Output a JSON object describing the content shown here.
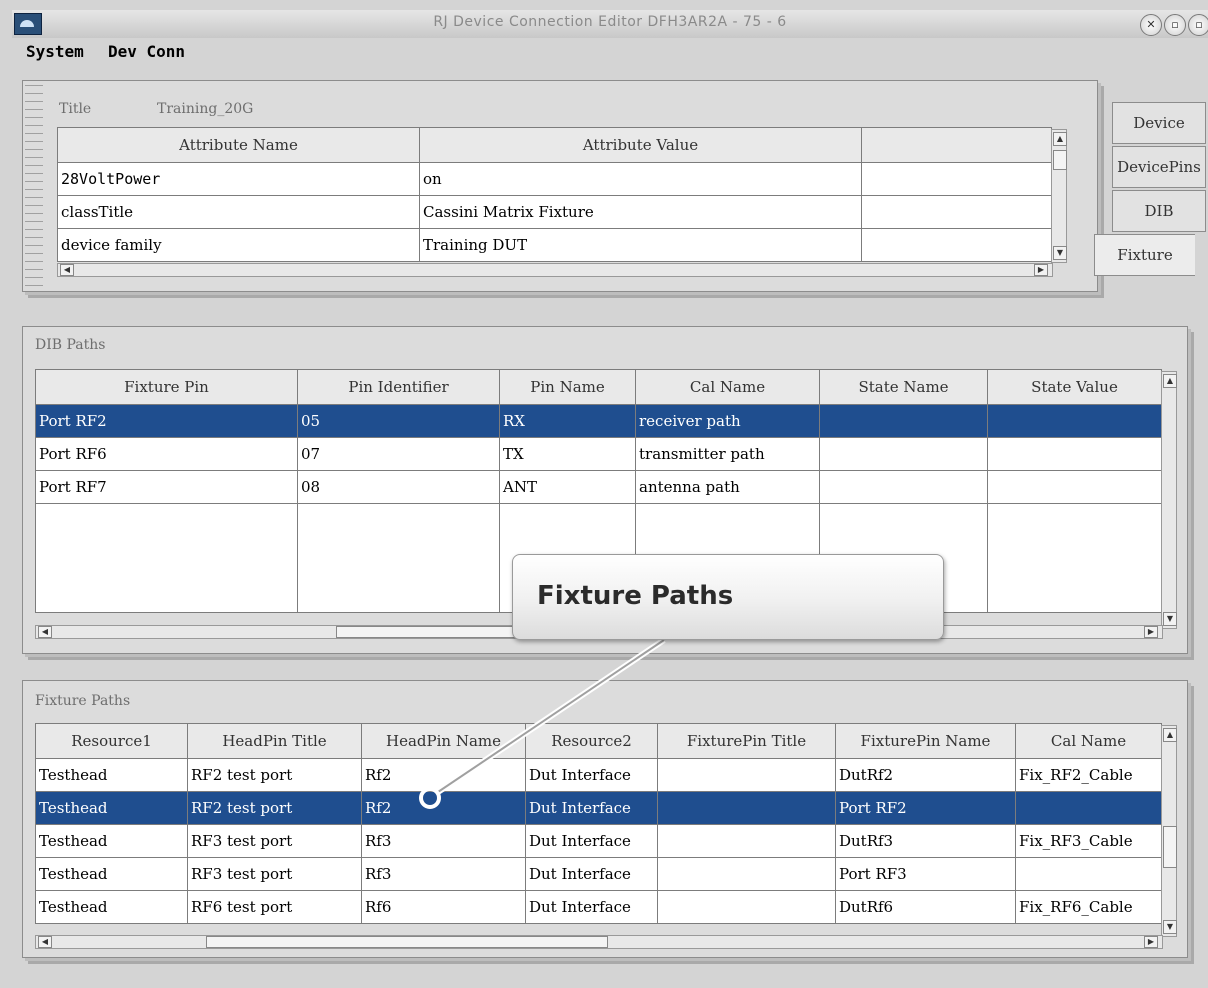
{
  "window": {
    "title": "RJ Device Connection Editor DFH3AR2A - 75 - 6"
  },
  "menu": [
    {
      "label": "System"
    },
    {
      "label": "Dev Conn"
    }
  ],
  "attributes": {
    "title_label": "Title",
    "title_value": "Training_20G",
    "columns": [
      "Attribute Name",
      "Attribute Value",
      ""
    ],
    "rows": [
      [
        "28VoltPower",
        "on",
        ""
      ],
      [
        "classTitle",
        "Cassini Matrix Fixture",
        ""
      ],
      [
        "device family",
        "Training DUT",
        ""
      ]
    ]
  },
  "tabs": [
    {
      "label": "Device"
    },
    {
      "label": "DevicePins"
    },
    {
      "label": "DIB"
    },
    {
      "label": "Fixture",
      "active": true
    }
  ],
  "dib_paths": {
    "label": "DIB Paths",
    "columns": [
      "Fixture Pin",
      "Pin Identifier",
      "Pin Name",
      "Cal Name",
      "State Name",
      "State Value"
    ],
    "rows": [
      {
        "cells": [
          "Port RF2",
          "05",
          "RX",
          "receiver path",
          "",
          ""
        ],
        "selected": true
      },
      {
        "cells": [
          "Port RF6",
          "07",
          "TX",
          "transmitter path",
          "",
          ""
        ],
        "selected": false
      },
      {
        "cells": [
          "Port RF7",
          "08",
          "ANT",
          "antenna path",
          "",
          ""
        ],
        "selected": false
      }
    ]
  },
  "fixture_paths": {
    "label": "Fixture Paths",
    "columns": [
      "Resource1",
      "HeadPin Title",
      "HeadPin Name",
      "Resource2",
      "FixturePin Title",
      "FixturePin Name",
      "Cal Name"
    ],
    "rows": [
      {
        "cells": [
          "Testhead",
          "RF2 test port",
          "Rf2",
          "Dut Interface",
          "",
          "DutRf2",
          "Fix_RF2_Cable"
        ],
        "selected": false
      },
      {
        "cells": [
          "Testhead",
          "RF2 test port",
          "Rf2",
          "Dut Interface",
          "",
          "Port RF2",
          ""
        ],
        "selected": true
      },
      {
        "cells": [
          "Testhead",
          "RF3 test port",
          "Rf3",
          "Dut Interface",
          "",
          "DutRf3",
          "Fix_RF3_Cable"
        ],
        "selected": false
      },
      {
        "cells": [
          "Testhead",
          "RF3 test port",
          "Rf3",
          "Dut Interface",
          "",
          "Port RF3",
          ""
        ],
        "selected": false
      },
      {
        "cells": [
          "Testhead",
          "RF6 test port",
          "Rf6",
          "Dut Interface",
          "",
          "DutRf6",
          "Fix_RF6_Cable"
        ],
        "selected": false
      }
    ]
  },
  "callout": {
    "text": "Fixture Paths"
  },
  "colors": {
    "selection": "#1f4e8f",
    "panel": "#dcdcdc"
  }
}
